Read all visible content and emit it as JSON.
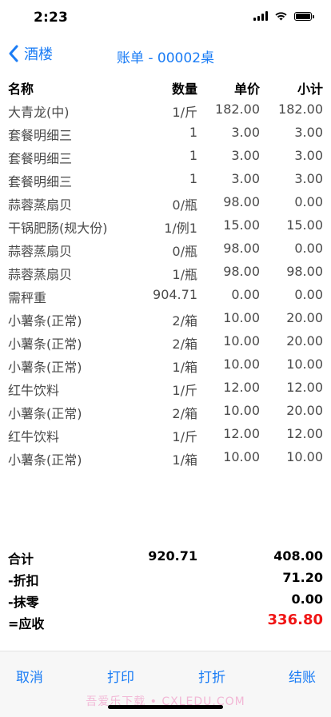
{
  "status": {
    "time": "2:23"
  },
  "nav": {
    "back_label": "酒楼",
    "title": "账单 - 00002桌"
  },
  "table": {
    "headers": {
      "name": "名称",
      "qty": "数量",
      "price": "单价",
      "subtotal": "小计"
    },
    "rows": [
      {
        "name": "大青龙(中)",
        "qty": "1/斤",
        "price": "182.00",
        "subtotal": "182.00"
      },
      {
        "name": "套餐明细三",
        "qty": "1",
        "price": "3.00",
        "subtotal": "3.00"
      },
      {
        "name": "套餐明细三",
        "qty": "1",
        "price": "3.00",
        "subtotal": "3.00"
      },
      {
        "name": "套餐明细三",
        "qty": "1",
        "price": "3.00",
        "subtotal": "3.00"
      },
      {
        "name": "蒜蓉蒸扇贝",
        "qty": "0/瓶",
        "price": "98.00",
        "subtotal": "0.00"
      },
      {
        "name": "干锅肥肠(规大份)",
        "qty": "1/例1",
        "price": "15.00",
        "subtotal": "15.00"
      },
      {
        "name": "蒜蓉蒸扇贝",
        "qty": "0/瓶",
        "price": "98.00",
        "subtotal": "0.00"
      },
      {
        "name": "蒜蓉蒸扇贝",
        "qty": "1/瓶",
        "price": "98.00",
        "subtotal": "98.00"
      },
      {
        "name": "需秤重",
        "qty": "904.71",
        "price": "0.00",
        "subtotal": "0.00"
      },
      {
        "name": "小薯条(正常)",
        "qty": "2/箱",
        "price": "10.00",
        "subtotal": "20.00"
      },
      {
        "name": "小薯条(正常)",
        "qty": "2/箱",
        "price": "10.00",
        "subtotal": "20.00"
      },
      {
        "name": "小薯条(正常)",
        "qty": "1/箱",
        "price": "10.00",
        "subtotal": "10.00"
      },
      {
        "name": "红牛饮料",
        "qty": "1/斤",
        "price": "12.00",
        "subtotal": "12.00"
      },
      {
        "name": "小薯条(正常)",
        "qty": "2/箱",
        "price": "10.00",
        "subtotal": "20.00"
      },
      {
        "name": "红牛饮料",
        "qty": "1/斤",
        "price": "12.00",
        "subtotal": "12.00"
      },
      {
        "name": "小薯条(正常)",
        "qty": "1/箱",
        "price": "10.00",
        "subtotal": "10.00"
      }
    ]
  },
  "totals": {
    "total_label": "合计",
    "total_qty": "920.71",
    "total_value": "408.00",
    "discount_label": "-折扣",
    "discount_value": "71.20",
    "rounding_label": "-抹零",
    "rounding_value": "0.00",
    "due_label": "=应收",
    "due_value": "336.80"
  },
  "actions": {
    "cancel": "取消",
    "print": "打印",
    "discount": "打折",
    "checkout": "结账"
  },
  "watermark": "吾爱乐下载 • CXLEDU.COM",
  "colors": {
    "accent": "#1a7cf5",
    "due": "#f01616"
  }
}
